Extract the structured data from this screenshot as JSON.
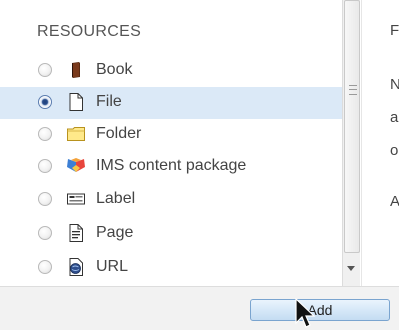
{
  "section": {
    "heading": "RESOURCES"
  },
  "items": [
    {
      "label": "Book",
      "icon": "book-icon",
      "checked": false
    },
    {
      "label": "File",
      "icon": "file-icon",
      "checked": true
    },
    {
      "label": "Folder",
      "icon": "folder-icon",
      "checked": false
    },
    {
      "label": "IMS content package",
      "icon": "ims-package-icon",
      "checked": false
    },
    {
      "label": "Label",
      "icon": "label-icon",
      "checked": false
    },
    {
      "label": "Page",
      "icon": "page-icon",
      "checked": false
    },
    {
      "label": "URL",
      "icon": "url-icon",
      "checked": false
    }
  ],
  "info": {
    "lines": [
      "F",
      "N",
      "a",
      "o",
      "A"
    ]
  },
  "footer": {
    "add_label": "Add"
  },
  "colors": {
    "selected_row": "#dbe9f7",
    "button_border": "#7aa4cf"
  }
}
